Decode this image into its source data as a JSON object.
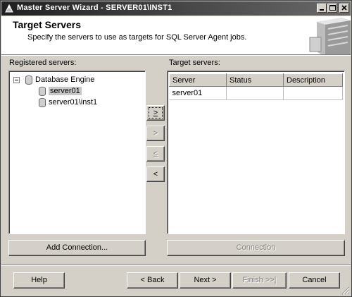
{
  "window": {
    "title": "Master Server Wizard - SERVER01\\INST1"
  },
  "header": {
    "title": "Target Servers",
    "subtitle": "Specify the servers to use as targets for SQL Server Agent jobs."
  },
  "registered": {
    "label": "Registered servers:",
    "root": "Database Engine",
    "items": [
      "server01",
      "server01\\inst1"
    ],
    "selected": "server01"
  },
  "target": {
    "label": "Target servers:",
    "columns": [
      "Server",
      "Status",
      "Description"
    ],
    "rows": [
      [
        "server01",
        "",
        ""
      ]
    ]
  },
  "move_buttons": {
    "add": ">",
    "add_all": ">",
    "remove": "<",
    "remove_all": "<"
  },
  "buttons": {
    "add_connection": "Add Connection...",
    "connection": "Connection",
    "help": "Help",
    "back": "< Back",
    "next": "Next >",
    "finish": "Finish >>|",
    "cancel": "Cancel"
  }
}
